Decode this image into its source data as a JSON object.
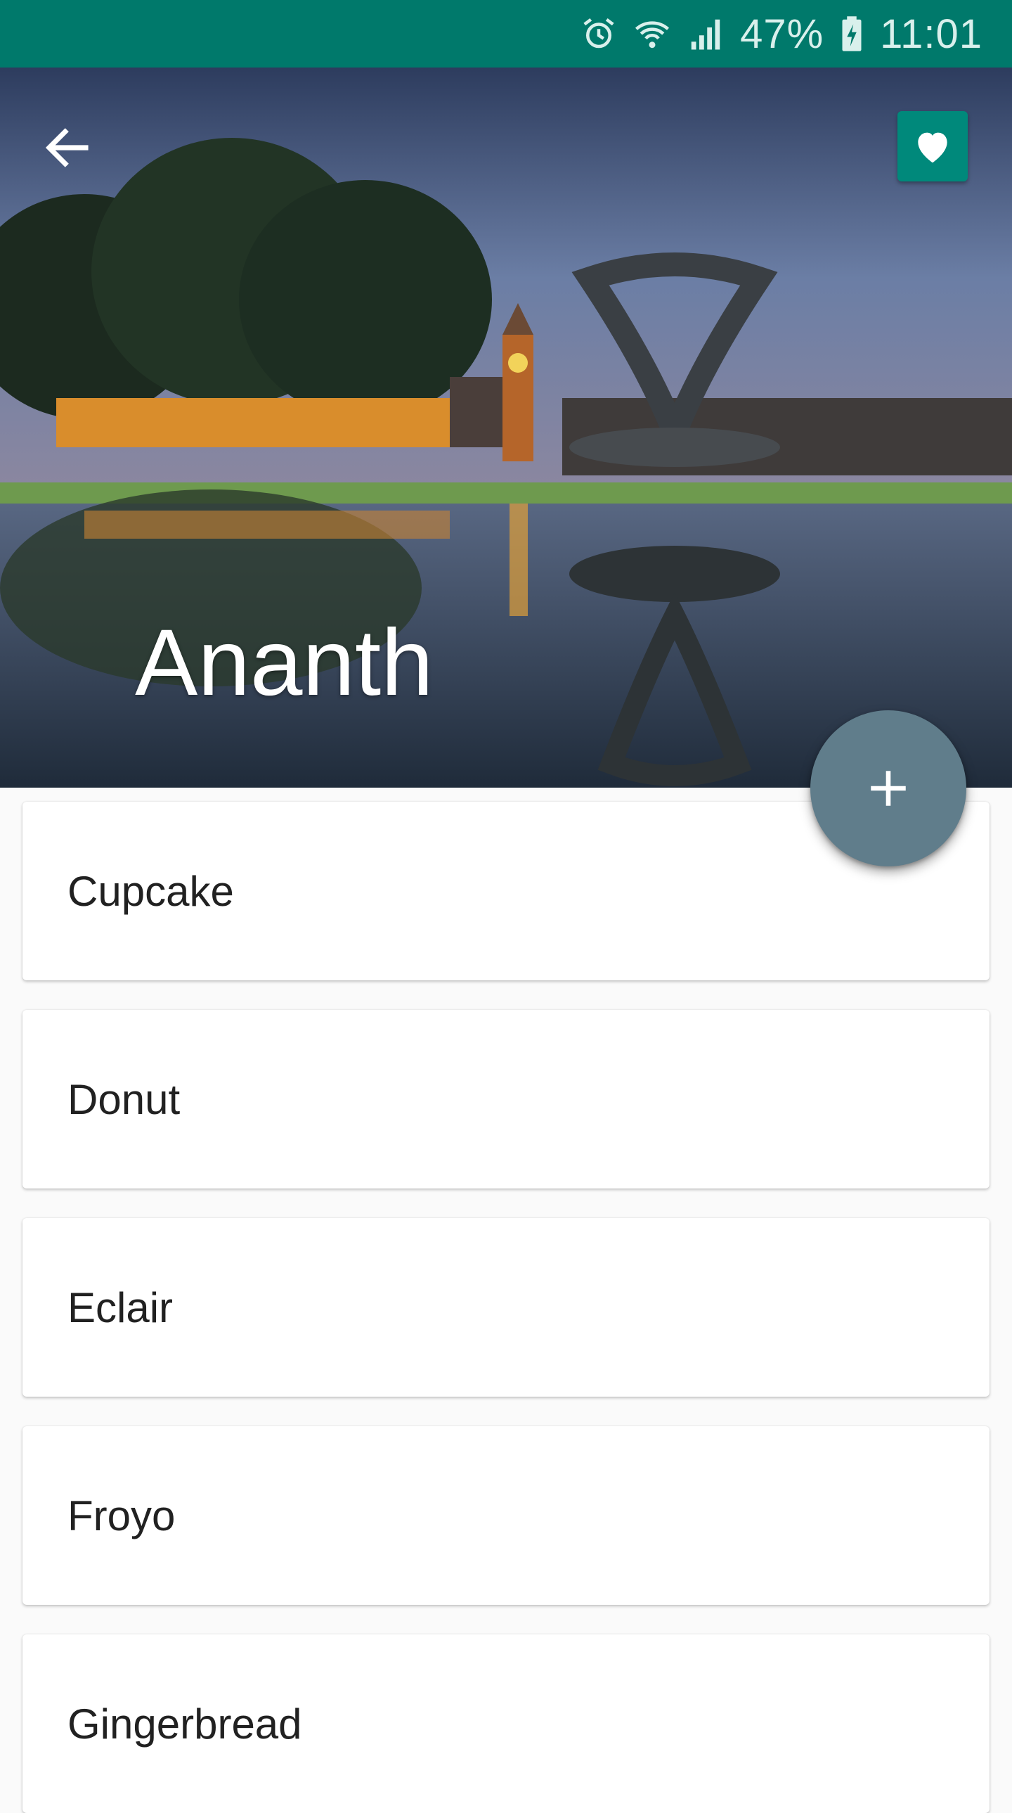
{
  "status_bar": {
    "battery_percent": "47%",
    "time": "11:01",
    "icons": [
      "alarm-icon",
      "wifi-icon",
      "signal-icon",
      "battery-charging-icon"
    ],
    "background": "#00796b"
  },
  "header": {
    "title": "Ananth",
    "back_icon": "arrow-back-icon",
    "favorite_icon": "heart-icon",
    "favorite_button_color": "#00897b"
  },
  "fab": {
    "icon": "plus-icon",
    "color": "#607d8b"
  },
  "list": {
    "items": [
      {
        "label": "Cupcake"
      },
      {
        "label": "Donut"
      },
      {
        "label": "Eclair"
      },
      {
        "label": "Froyo"
      },
      {
        "label": "Gingerbread"
      }
    ]
  }
}
